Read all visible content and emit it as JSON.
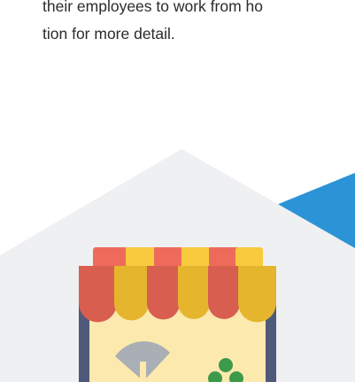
{
  "document": {
    "paragraph_lines": [
      "their employees to work from ho",
      "tion for more detail."
    ]
  },
  "illustration": {
    "icon": "storefront-awning-icon",
    "colors": {
      "hexagon": "#EFF0F2",
      "accent_blue": "#2C93D6",
      "awning_red": "#EE6B5B",
      "awning_red_shadow": "#D85E50",
      "awning_yellow": "#F8CB3E",
      "awning_yellow_shadow": "#E5B52D",
      "shop_wall": "#FCE9AE",
      "shop_frame": "#4F5979",
      "fan_gray": "#A9AFB4",
      "plant_green": "#3C9A4A"
    }
  }
}
